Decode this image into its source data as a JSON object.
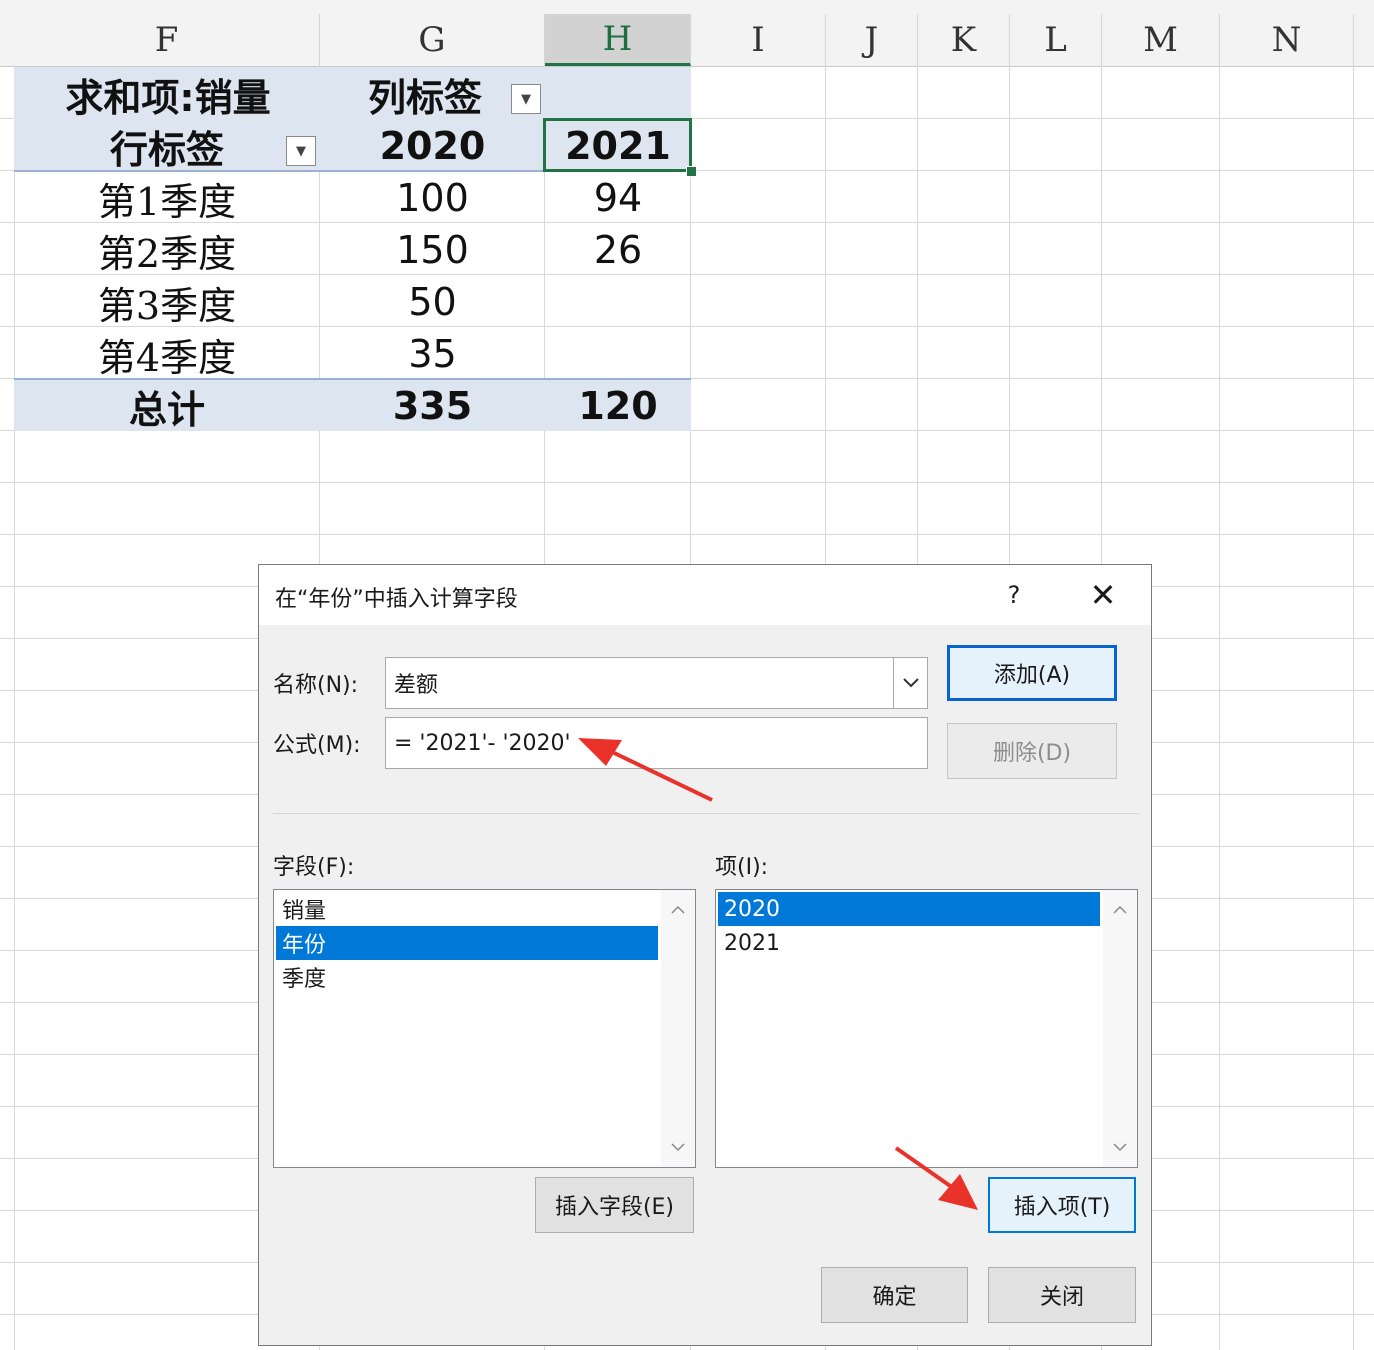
{
  "sheet": {
    "columns": [
      "F",
      "G",
      "H",
      "I",
      "J",
      "K",
      "L",
      "M",
      "N"
    ],
    "selected_column": "H"
  },
  "pivot": {
    "header_sum_label": "求和项:销量",
    "header_col_label": "列标签",
    "header_row_label": "行标签",
    "years": [
      "2020",
      "2021"
    ],
    "rows": [
      {
        "label": "第1季度",
        "v2020": "100",
        "v2021": "94"
      },
      {
        "label": "第2季度",
        "v2020": "150",
        "v2021": "26"
      },
      {
        "label": "第3季度",
        "v2020": "50",
        "v2021": ""
      },
      {
        "label": "第4季度",
        "v2020": "35",
        "v2021": ""
      }
    ],
    "total": {
      "label": "总计",
      "v2020": "335",
      "v2021": "120"
    },
    "filter_icon": "dropdown-arrow-icon"
  },
  "dialog": {
    "title": "在“年份”中插入计算字段",
    "help": "?",
    "close": "✕",
    "name_label": "名称(N):",
    "name_value": "差额",
    "formula_label": "公式(M):",
    "formula_value": "= '2021'- '2020'",
    "add_button": "添加(A)",
    "delete_button": "删除(D)",
    "fields_label": "字段(F):",
    "fields": [
      "销量",
      "年份",
      "季度"
    ],
    "fields_selected": "年份",
    "items_label": "项(I):",
    "items": [
      "2020",
      "2021"
    ],
    "items_selected": "2020",
    "insert_field_button": "插入字段(E)",
    "insert_item_button": "插入项(T)",
    "ok_button": "确定",
    "close_button": "关闭"
  },
  "colors": {
    "pivot_band": "#dde5f0",
    "excel_green": "#217346",
    "selection_blue": "#0078d7",
    "annotation_red": "#e8322a"
  }
}
